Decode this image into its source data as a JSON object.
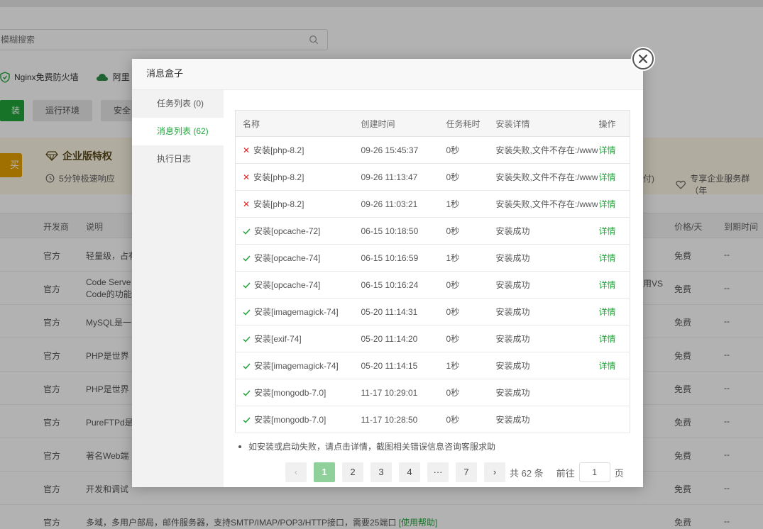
{
  "background": {
    "search_placeholder": "模糊搜索",
    "plugins": [
      "Nginx免费防火墙",
      "阿里"
    ],
    "tabs": [
      "装",
      "运行环境",
      "安全"
    ],
    "enterprise": {
      "buy_label": "买",
      "title": "企业版特权",
      "subtitle": "5分钟极速响应",
      "right_suffix": "付)",
      "right_service": "专享企业服务群（年"
    },
    "table": {
      "headers": [
        "开发商",
        "说明",
        "价格/天",
        "到期时间"
      ],
      "rows": [
        {
          "vendor": "官方",
          "desc": "轻量级，占有",
          "price": "免费",
          "expire": "--"
        },
        {
          "vendor": "官方",
          "desc": "Code Serve",
          "desc2": "Code的功能",
          "extra": "用VS",
          "price": "免费",
          "expire": "--"
        },
        {
          "vendor": "官方",
          "desc": "MySQL是一",
          "price": "免费",
          "expire": "--"
        },
        {
          "vendor": "官方",
          "desc": "PHP是世界",
          "price": "免费",
          "expire": "--"
        },
        {
          "vendor": "官方",
          "desc": "PHP是世界",
          "price": "免费",
          "expire": "--"
        },
        {
          "vendor": "官方",
          "desc": "PureFTPd是",
          "price": "免费",
          "expire": "--"
        },
        {
          "vendor": "官方",
          "desc": "著名Web端",
          "price": "免费",
          "expire": "--"
        },
        {
          "vendor": "官方",
          "desc": "开发和调试",
          "price": "免费",
          "expire": "--"
        },
        {
          "vendor": "官方",
          "desc": "多域，多用户部局，邮件服务器，支持SMTP/IMAP/POP3/HTTP接口，需要25端口",
          "link": "[使用帮助]",
          "price": "免费",
          "expire": "--"
        }
      ]
    }
  },
  "dialog": {
    "title": "消息盒子",
    "sidebar": [
      {
        "label": "任务列表 (0)",
        "active": false
      },
      {
        "label": "消息列表 (62)",
        "active": true
      },
      {
        "label": "执行日志",
        "active": false
      }
    ],
    "columns": [
      "名称",
      "创建时间",
      "任务耗时",
      "安装详情",
      "操作"
    ],
    "rows": [
      {
        "status": "fail",
        "name": "安装[php-8.2]",
        "time": "09-26 15:45:37",
        "duration": "0秒",
        "detail": "安装失败,文件不存在:/www/",
        "action": "详情"
      },
      {
        "status": "fail",
        "name": "安装[php-8.2]",
        "time": "09-26 11:13:47",
        "duration": "0秒",
        "detail": "安装失败,文件不存在:/www/",
        "action": "详情"
      },
      {
        "status": "fail",
        "name": "安装[php-8.2]",
        "time": "09-26 11:03:21",
        "duration": "1秒",
        "detail": "安装失败,文件不存在:/www/",
        "action": "详情"
      },
      {
        "status": "ok",
        "name": "安装[opcache-72]",
        "time": "06-15 10:18:50",
        "duration": "0秒",
        "detail": "安装成功",
        "action": "详情"
      },
      {
        "status": "ok",
        "name": "安装[opcache-74]",
        "time": "06-15 10:16:59",
        "duration": "1秒",
        "detail": "安装成功",
        "action": "详情"
      },
      {
        "status": "ok",
        "name": "安装[opcache-74]",
        "time": "06-15 10:16:24",
        "duration": "0秒",
        "detail": "安装成功",
        "action": "详情"
      },
      {
        "status": "ok",
        "name": "安装[imagemagick-74]",
        "time": "05-20 11:14:31",
        "duration": "0秒",
        "detail": "安装成功",
        "action": "详情"
      },
      {
        "status": "ok",
        "name": "安装[exif-74]",
        "time": "05-20 11:14:20",
        "duration": "0秒",
        "detail": "安装成功",
        "action": "详情"
      },
      {
        "status": "ok",
        "name": "安装[imagemagick-74]",
        "time": "05-20 11:14:15",
        "duration": "1秒",
        "detail": "安装成功",
        "action": "详情"
      },
      {
        "status": "ok",
        "name": "安装[mongodb-7.0]",
        "time": "11-17 10:29:01",
        "duration": "0秒",
        "detail": "安装成功",
        "action": ""
      },
      {
        "status": "ok",
        "name": "安装[mongodb-7.0]",
        "time": "11-17 10:28:50",
        "duration": "0秒",
        "detail": "安装成功",
        "action": ""
      }
    ],
    "note": "如安装或启动失败，请点击详情，截图相关错误信息咨询客服求助",
    "pagination": {
      "prev": "‹",
      "pages": [
        "1",
        "2",
        "3",
        "4",
        "···",
        "7"
      ],
      "active": "1",
      "next": "›",
      "total": "共 62 条",
      "goto_label": "前往",
      "goto_value": "1",
      "page_unit": "页"
    }
  },
  "colors": {
    "accent": "#20a53a",
    "error": "#e02020",
    "pager_active": "#8fd09b",
    "enterprise_bg": "#fdf6e4",
    "enterprise_button": "#e6a100"
  }
}
